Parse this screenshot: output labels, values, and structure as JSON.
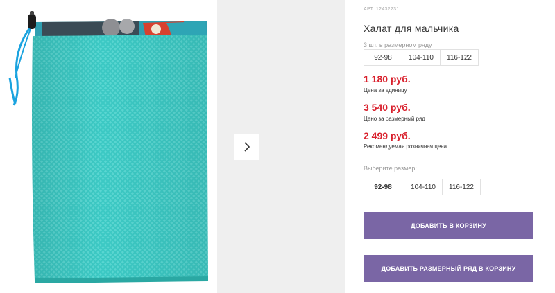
{
  "product": {
    "art": "АРТ. 12432231",
    "title": "Халат для мальчика",
    "qty_note": "3 шт. в размерном ряду",
    "sizes_row": [
      "92-98",
      "104-110",
      "116-122"
    ]
  },
  "prices": [
    {
      "value": "1 180 руб.",
      "label": "Цена за единицу"
    },
    {
      "value": "3 540 руб.",
      "label": "Цено за размерный ряд"
    },
    {
      "value": "2 499 руб.",
      "label": "Рекомендуемая розничная цена"
    }
  ],
  "size_select": {
    "label": "Выберите размер:",
    "options": [
      "92-98",
      "104-110",
      "116-122"
    ],
    "selected": "92-98"
  },
  "buttons": {
    "add_to_cart": "ДОБАВИТЬ В КОРЗИНУ",
    "add_size_row": "ДОБАВИТЬ РАЗМЕРНЫЙ РЯД В КОРЗИНУ"
  },
  "colors": {
    "price_red": "#d9212d",
    "button_purple": "#7a66a5",
    "mesh_turquoise": "#34c6c2",
    "drawstring_blue": "#1aa3df"
  },
  "icons": {
    "next_arrow": "chevron-right-icon"
  }
}
